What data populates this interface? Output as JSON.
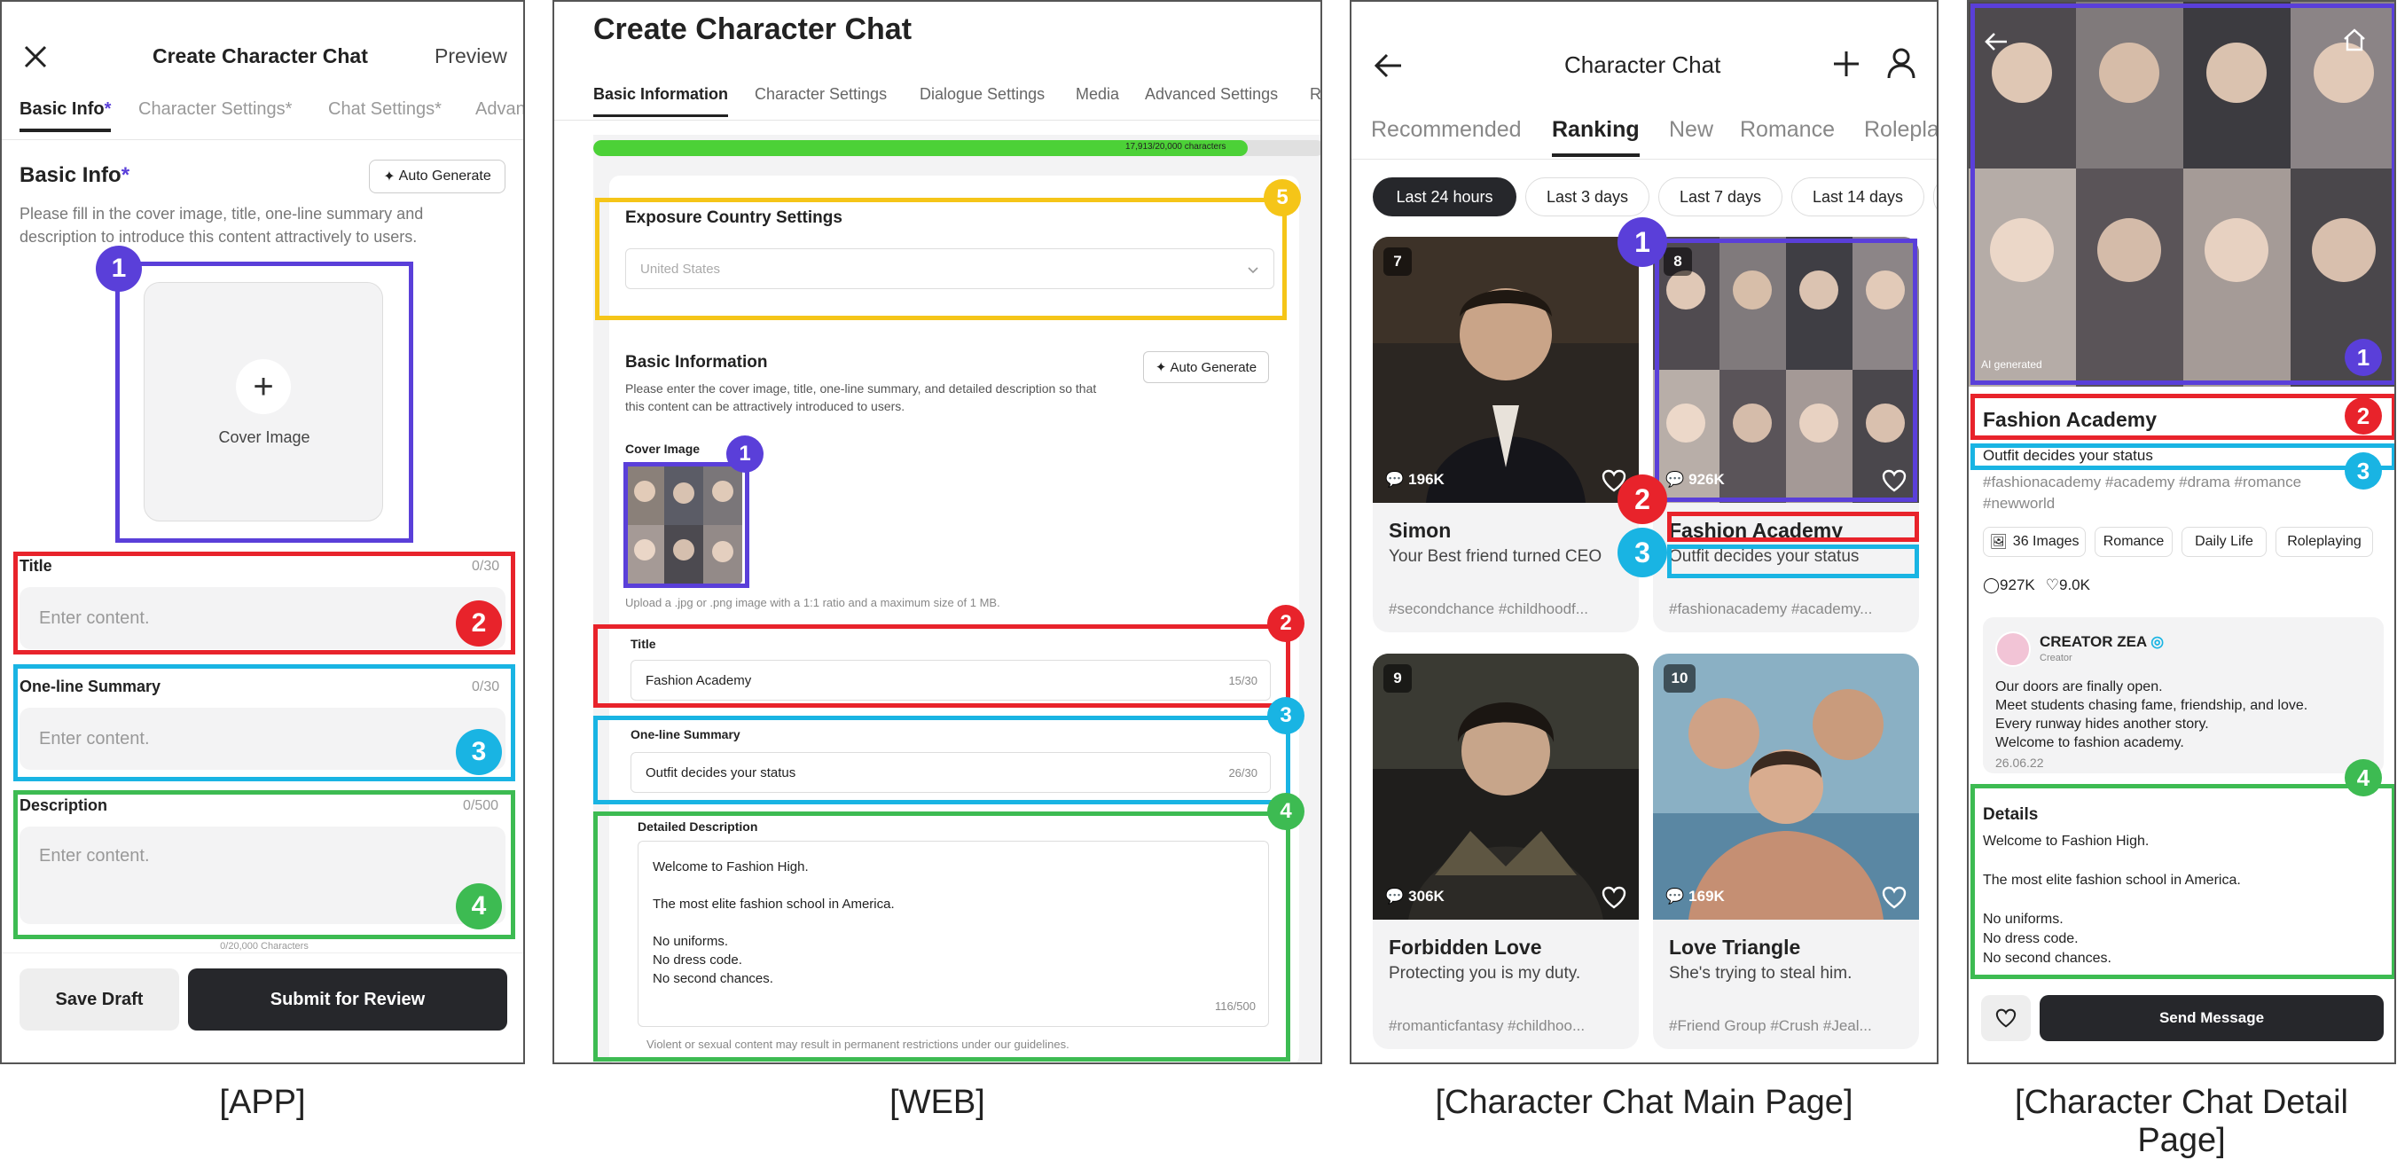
{
  "captions": {
    "app": "[APP]",
    "web": "[WEB]",
    "main": "[Character Chat Main Page]",
    "detail": "[Character Chat Detail Page]"
  },
  "app": {
    "title": "Create Character Chat",
    "preview": "Preview",
    "tabs": [
      "Basic Info",
      "Character Settings*",
      "Chat Settings*",
      "Advan"
    ],
    "section_title": "Basic Info",
    "auto_generate": "Auto Generate",
    "description": "Please fill in the cover image, title, one-line summary and description to introduce this content attractively to users.",
    "cover_label": "Cover Image",
    "title_label": "Title",
    "title_count": "0/30",
    "title_placeholder": "Enter content.",
    "summary_label": "One-line Summary",
    "summary_count": "0/30",
    "summary_placeholder": "Enter content.",
    "desc_label": "Description",
    "desc_count": "0/500",
    "desc_placeholder": "Enter content.",
    "char_count": "0/20,000 Characters",
    "save_draft": "Save Draft",
    "submit": "Submit for Review"
  },
  "web": {
    "title": "Create Character Chat",
    "tabs": [
      "Basic Information",
      "Character Settings",
      "Dialogue Settings",
      "Media",
      "Advanced Settings",
      "R"
    ],
    "progress_text": "17,913/20,000 characters",
    "progress": 0.8957,
    "exposure_title": "Exposure Country Settings",
    "country": "United States",
    "basic_title": "Basic Information",
    "auto_generate": "Auto Generate",
    "basic_desc": "Please enter the cover image, title, one-line summary, and detailed description so that this content can be attractively introduced to users.",
    "cover_label": "Cover Image",
    "upload_hint": "Upload a .jpg or .png image with a 1:1 ratio and a maximum size of 1 MB.",
    "title_label": "Title",
    "title_value": "Fashion Academy",
    "title_count": "15/30",
    "summary_label": "One-line Summary",
    "summary_value": "Outfit decides your status",
    "summary_count": "26/30",
    "desc_label": "Detailed Description",
    "desc_lines": [
      "Welcome to Fashion High.",
      "",
      "The most elite fashion school in America.",
      "",
      "No uniforms.",
      "No dress code.",
      "No second chances."
    ],
    "desc_count": "116/500",
    "guideline": "Violent or sexual content may result in permanent restrictions under our guidelines."
  },
  "main": {
    "title": "Character Chat",
    "tabs": [
      "Recommended",
      "Ranking",
      "New",
      "Romance",
      "Rolepla"
    ],
    "filters": [
      "Last 24 hours",
      "Last 3 days",
      "Last 7 days",
      "Last 14 days"
    ],
    "cards": [
      {
        "rank": "7",
        "views": "196K",
        "name": "Simon",
        "summary": "Your Best friend turned CEO",
        "tags": "#secondchance #childhoodf..."
      },
      {
        "rank": "8",
        "views": "926K",
        "name": "Fashion Academy",
        "summary": "Outfit decides your status",
        "tags": "#fashionacademy #academy..."
      },
      {
        "rank": "9",
        "views": "306K",
        "name": "Forbidden Love",
        "summary": "Protecting you is my duty.",
        "tags": "#romanticfantasy #childhoo..."
      },
      {
        "rank": "10",
        "views": "169K",
        "name": "Love Triangle",
        "summary": "She's trying to steal him.",
        "tags": "#Friend Group #Crush #Jeal..."
      }
    ]
  },
  "detail": {
    "ai_label": "AI generated",
    "title": "Fashion Academy",
    "summary": "Outfit decides your status",
    "hashtags": "#fashionacademy #academy #drama #romance #newworld",
    "chips": [
      "36 Images",
      "Romance",
      "Daily Life",
      "Roleplaying"
    ],
    "views": "927K",
    "likes": "9.0K",
    "creator_name": "CREATOR ZEA",
    "creator_role": "Creator",
    "creator_msg": [
      "Our doors are finally open.",
      "Meet students chasing fame, friendship, and love.",
      "Every runway hides another story.",
      "Welcome to fashion academy."
    ],
    "date": "26.06.22",
    "details_title": "Details",
    "details_lines": [
      "Welcome to Fashion High.",
      "",
      "The most elite fashion school in America.",
      "",
      "No uniforms.",
      "No dress code.",
      "No second chances."
    ],
    "send": "Send Message"
  },
  "markers": {
    "m1": "1",
    "m2": "2",
    "m3": "3",
    "m4": "4",
    "m5": "5"
  },
  "colors": {
    "purple": "#5a3fd9",
    "red": "#e8232b",
    "cyan": "#19b4e3",
    "green": "#3dbb52",
    "yellow": "#f5c518",
    "progress": "#4cd137",
    "dark_button": "#26272b"
  },
  "icons": [
    "close-icon",
    "plus-icon",
    "back-arrow-icon",
    "user-icon",
    "home-icon",
    "chevron-down-icon",
    "chat-bubble-icon",
    "heart-icon",
    "image-icon",
    "sparkle-icon"
  ]
}
